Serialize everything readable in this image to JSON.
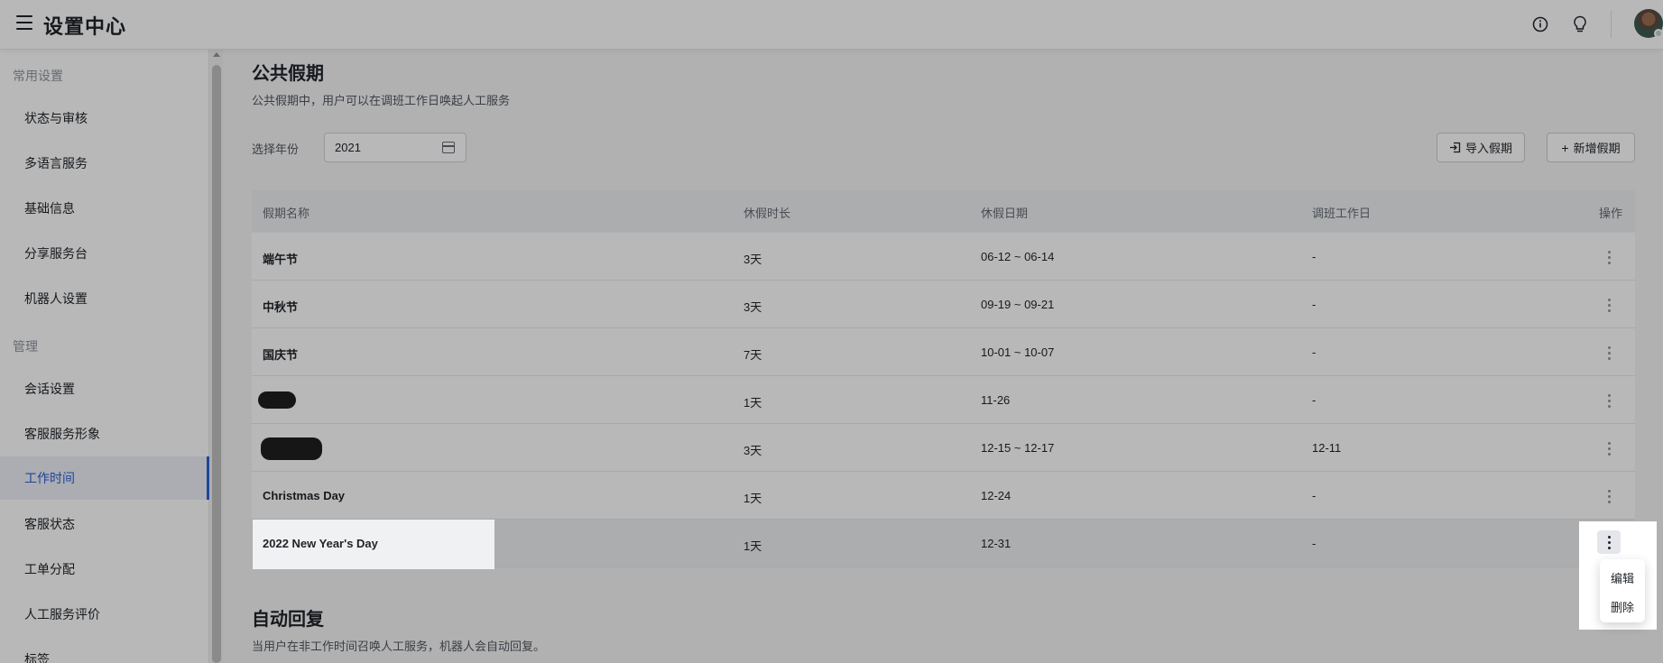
{
  "header": {
    "title": "设置中心",
    "icons": [
      "menu-icon",
      "info-icon",
      "lightbulb-icon",
      "avatar"
    ]
  },
  "sidebar": {
    "groups": [
      {
        "label": "常用设置",
        "items": [
          "状态与审核",
          "多语言服务",
          "基础信息",
          "分享服务台",
          "机器人设置"
        ]
      },
      {
        "label": "管理",
        "items": [
          "会话设置",
          "客服服务形象",
          "工作时间",
          "客服状态",
          "工单分配",
          "人工服务评价",
          "标签"
        ]
      }
    ],
    "active_item": "工作时间"
  },
  "holiday": {
    "title": "公共假期",
    "desc": "公共假期中，用户可以在调班工作日唤起人工服务",
    "year_label": "选择年份",
    "year_value": "2021",
    "import_label": "导入假期",
    "add_label": "新增假期",
    "columns": [
      "假期名称",
      "休假时长",
      "休假日期",
      "调班工作日",
      "操作"
    ],
    "rows": [
      {
        "name": "端午节",
        "duration": "3天",
        "dates": "06-12 ~ 06-14",
        "workday": "-"
      },
      {
        "name": "中秋节",
        "duration": "3天",
        "dates": "09-19 ~ 09-21",
        "workday": "-"
      },
      {
        "name": "国庆节",
        "duration": "7天",
        "dates": "10-01 ~ 10-07",
        "workday": "-"
      },
      {
        "name": "",
        "duration": "1天",
        "dates": "11-26",
        "workday": "-"
      },
      {
        "name": "",
        "duration": "3天",
        "dates": "12-15 ~ 12-17",
        "workday": "12-11"
      },
      {
        "name": "Christmas Day",
        "duration": "1天",
        "dates": "12-24",
        "workday": "-"
      },
      {
        "name": "2022 New Year's Day",
        "duration": "1天",
        "dates": "12-31",
        "workday": "-"
      }
    ],
    "menu": {
      "edit": "编辑",
      "delete": "删除"
    }
  },
  "auto_reply": {
    "title": "自动回复",
    "desc": "当用户在非工作时间召唤人工服务，机器人会自动回复。"
  },
  "colors": {
    "accent": "#2b5fd9"
  }
}
